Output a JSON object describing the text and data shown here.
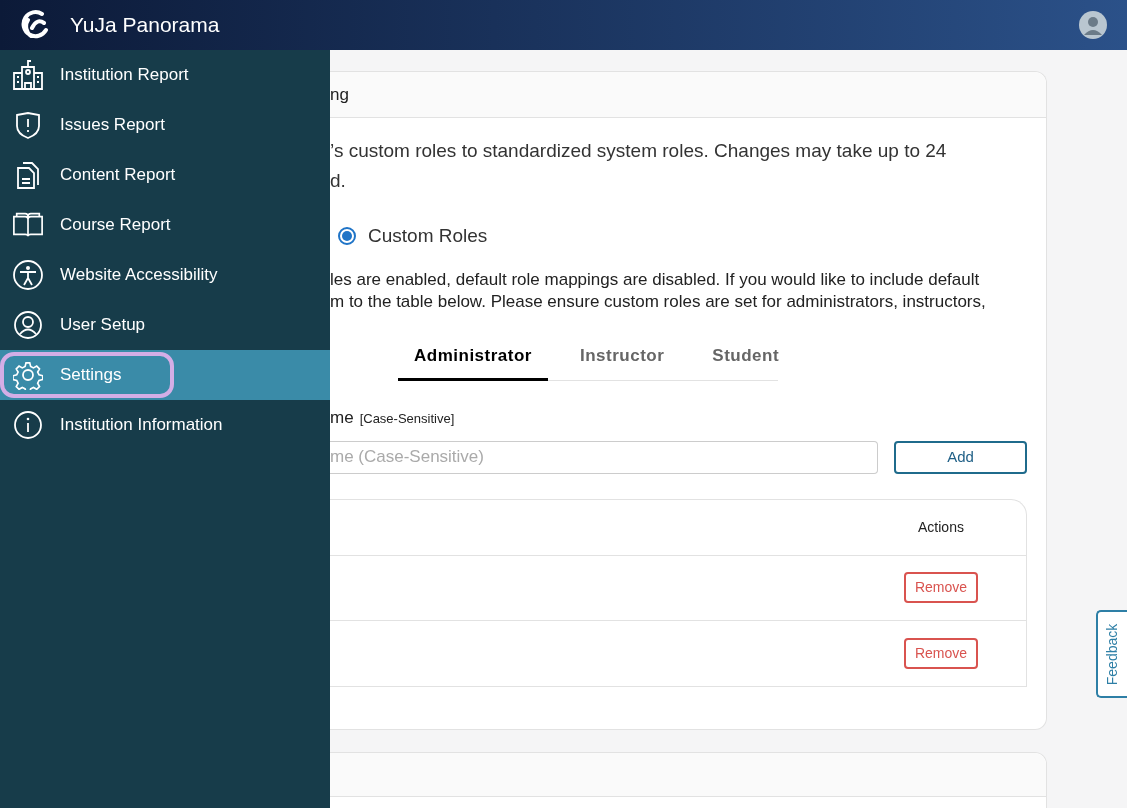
{
  "header": {
    "brand": "YuJa Panorama"
  },
  "sidebar": {
    "items": [
      {
        "label": "Institution Report",
        "selected": false
      },
      {
        "label": "Issues Report",
        "selected": false
      },
      {
        "label": "Content Report",
        "selected": false
      },
      {
        "label": "Course Report",
        "selected": false
      },
      {
        "label": "Website Accessibility",
        "selected": false
      },
      {
        "label": "User Setup",
        "selected": false
      },
      {
        "label": "Settings",
        "selected": true
      },
      {
        "label": "Institution Information",
        "selected": false
      }
    ]
  },
  "card": {
    "title": "ng",
    "intro_lines": [
      "’s custom roles to standardized system roles. Changes may take up to 24",
      "d."
    ],
    "radios": [
      {
        "label": "Custom Roles",
        "selected": true
      }
    ],
    "note_lines": [
      "les are enabled, default role mappings are disabled. If you would like to include default",
      "m to the table below. Please ensure custom roles are set for administrators, instructors,"
    ],
    "tabs": [
      {
        "label": "Administrator",
        "selected": true
      },
      {
        "label": "Instructor",
        "selected": false
      },
      {
        "label": "Student",
        "selected": false
      }
    ],
    "field_label": "me",
    "field_hint": "[Case-Sensitive]",
    "input": {
      "placeholder": "me (Case-Sensitive)"
    },
    "add_button": "Add",
    "table": {
      "columns": [
        "Actions"
      ],
      "rows": [
        {
          "action": "Remove"
        },
        {
          "action": "Remove"
        }
      ]
    }
  },
  "feedback": "Feedback"
}
